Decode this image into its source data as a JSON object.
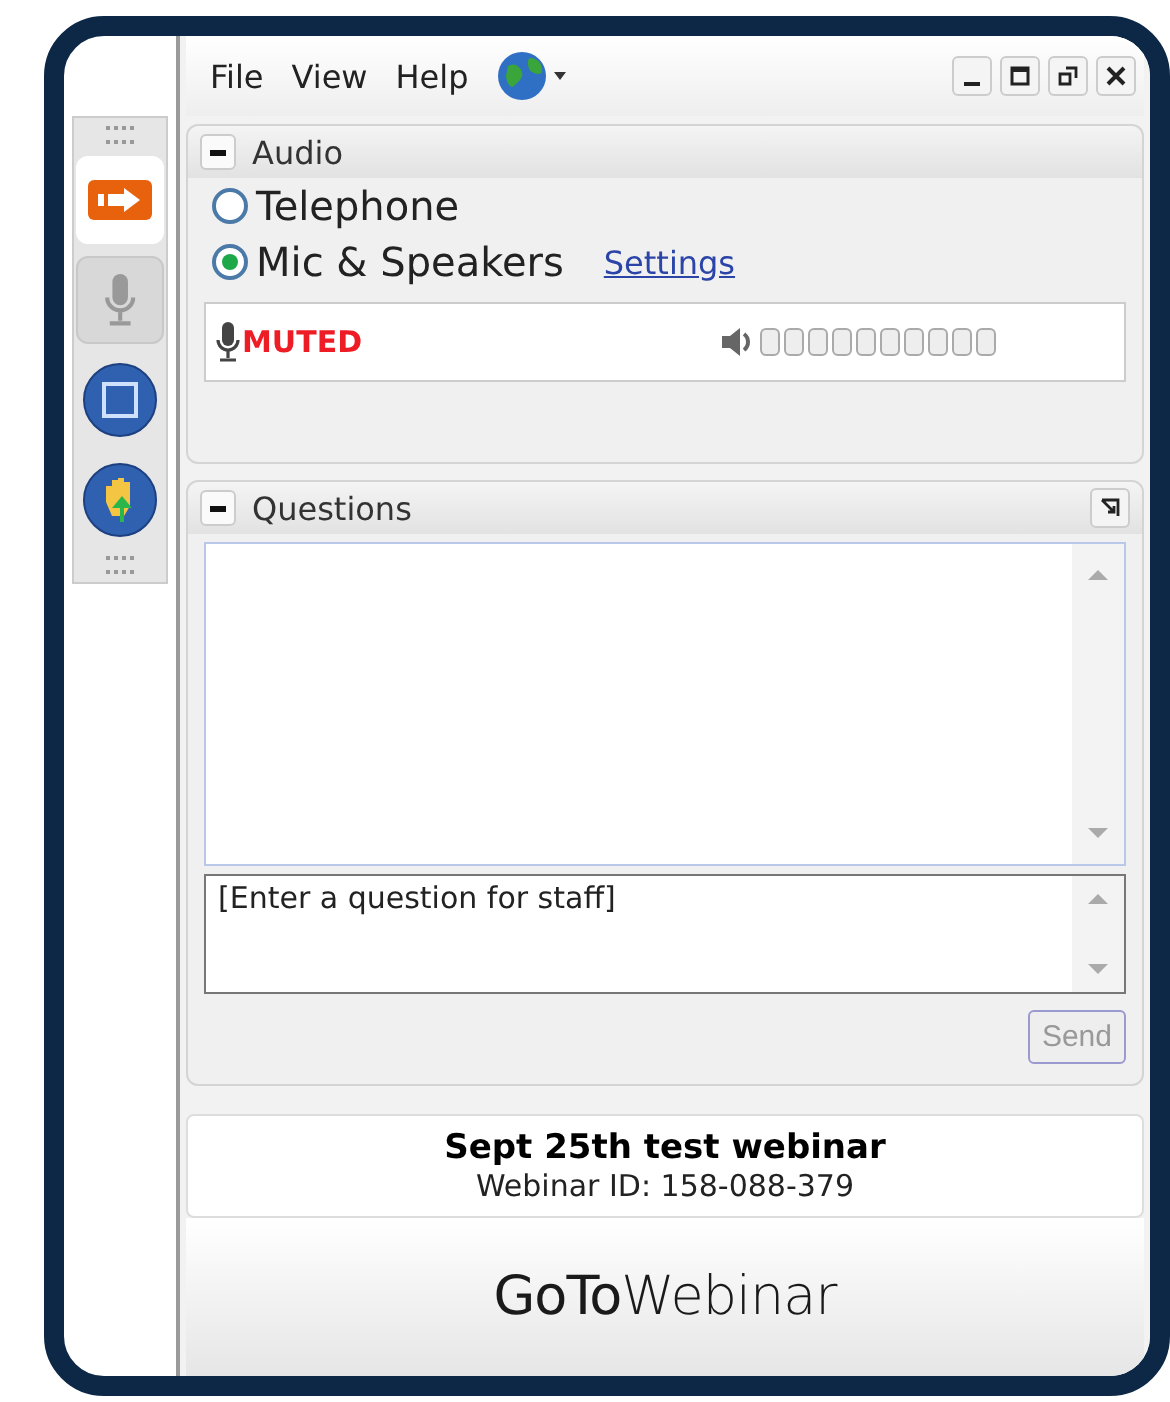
{
  "toolbar": [
    {
      "kind": "arrow",
      "selected": true
    },
    {
      "kind": "mic",
      "selected": false
    },
    {
      "kind": "screen",
      "selected": false
    },
    {
      "kind": "hand",
      "selected": false
    }
  ],
  "menu": [
    "File",
    "View",
    "Help"
  ],
  "audio": {
    "title": "Audio",
    "expanded": true,
    "options": [
      {
        "label": "Telephone",
        "selected": false
      },
      {
        "label": "Mic & Speakers",
        "selected": true
      }
    ],
    "settings_link": "Settings",
    "mic_status": "MUTED"
  },
  "questions": {
    "title": "Questions",
    "expanded": true,
    "placeholder": "[Enter a question for staff]",
    "send": {
      "label": "Send",
      "disabled": true
    }
  },
  "webinar": {
    "title": "Sept 25th test webinar",
    "id": "Webinar ID: 158-088-379"
  },
  "logo": "**GoTo**Webinar"
}
